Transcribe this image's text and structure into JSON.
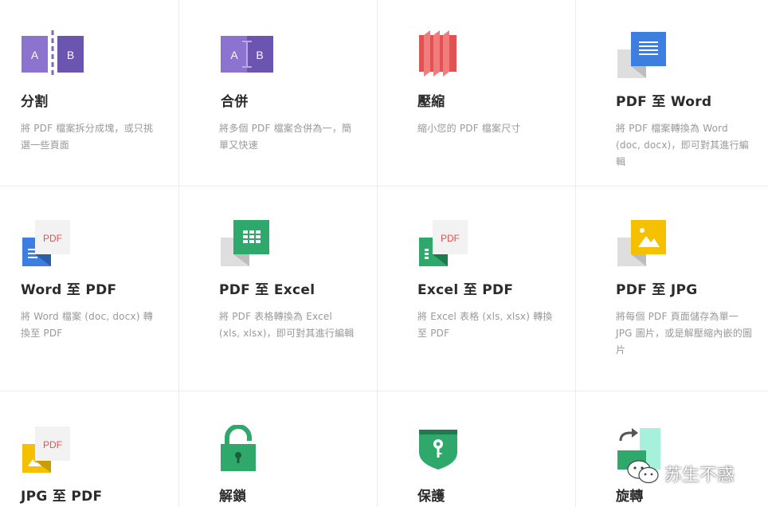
{
  "tools": [
    {
      "title": "分割",
      "desc": "將 PDF 檔案拆分成塊，或只挑選一些頁面",
      "icon": "split-icon"
    },
    {
      "title": "合併",
      "desc": "將多個 PDF 檔案合併為一，簡單又快速",
      "icon": "merge-icon"
    },
    {
      "title": "壓縮",
      "desc": "縮小您的 PDF 檔案尺寸",
      "icon": "compress-icon"
    },
    {
      "title": "PDF 至 Word",
      "desc": "將 PDF 檔案轉換為 Word (doc, docx)，即可對其進行編輯",
      "icon": "pdf-to-word-icon"
    },
    {
      "title": "Word 至 PDF",
      "desc": "將 Word 檔案 (doc, docx) 轉換至 PDF",
      "icon": "word-to-pdf-icon"
    },
    {
      "title": "PDF 至 Excel",
      "desc": "將 PDF 表格轉換為 Excel (xls, xlsx)，即可對其進行編輯",
      "icon": "pdf-to-excel-icon"
    },
    {
      "title": "Excel 至 PDF",
      "desc": "將 Excel 表格 (xls, xlsx) 轉換至 PDF",
      "icon": "excel-to-pdf-icon"
    },
    {
      "title": "PDF 至 JPG",
      "desc": "將每個 PDF 頁面儲存為單一 JPG 圖片，或是解壓縮內嵌的圖片",
      "icon": "pdf-to-jpg-icon"
    },
    {
      "title": "JPG 至 PDF",
      "desc": "",
      "icon": "jpg-to-pdf-icon"
    },
    {
      "title": "解鎖",
      "desc": "",
      "icon": "unlock-icon"
    },
    {
      "title": "保護",
      "desc": "",
      "icon": "protect-icon"
    },
    {
      "title": "旋轉",
      "desc": "",
      "icon": "rotate-icon"
    }
  ],
  "icon_labels": {
    "a": "A",
    "b": "B",
    "pdf": "PDF"
  },
  "colors": {
    "purple": "#7e67c0",
    "purple_dark": "#6c55b0",
    "red": "#e35252",
    "blue": "#3c7fe0",
    "green": "#2ea86b",
    "yellow": "#f5c000",
    "teal": "#8ff0d6",
    "gray": "#dedede"
  },
  "watermark": {
    "text": "苏生不惑",
    "icon": "wechat-icon"
  }
}
